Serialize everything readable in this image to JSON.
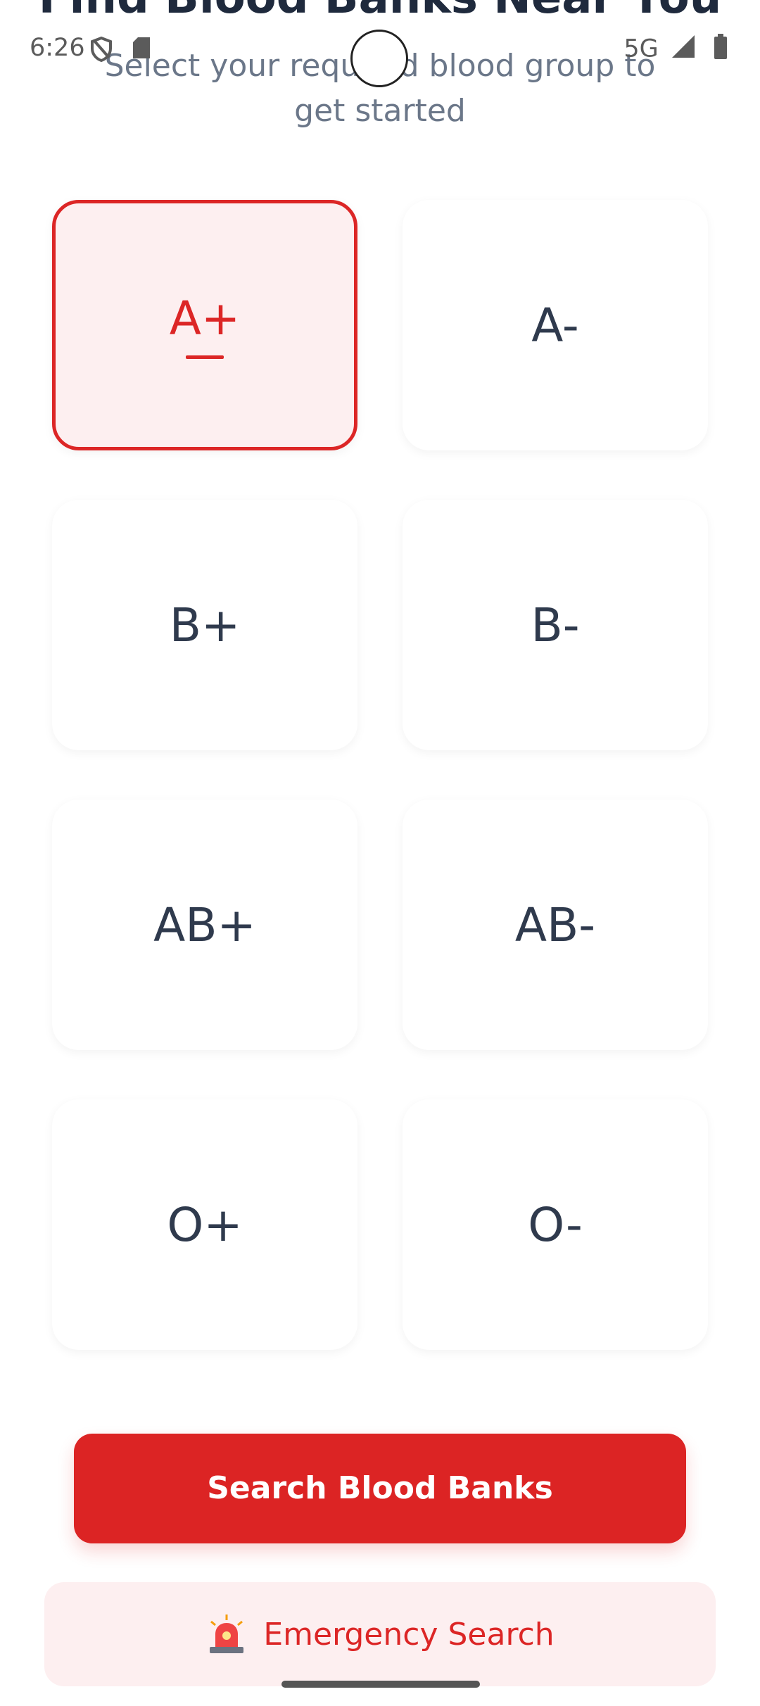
{
  "header": {
    "title": "Find Blood Banks Near You",
    "subtitle": "Select your required blood group to get started"
  },
  "status_bar": {
    "time": "6:26",
    "network": "5G"
  },
  "blood_groups": [
    {
      "label": "A+",
      "selected": true
    },
    {
      "label": "A-",
      "selected": false
    },
    {
      "label": "B+",
      "selected": false
    },
    {
      "label": "B-",
      "selected": false
    },
    {
      "label": "AB+",
      "selected": false
    },
    {
      "label": "AB-",
      "selected": false
    },
    {
      "label": "O+",
      "selected": false
    },
    {
      "label": "O-",
      "selected": false
    }
  ],
  "actions": {
    "search_label": "Search Blood Banks",
    "emergency_label": "Emergency Search",
    "emergency_icon": "siren-icon"
  },
  "colors": {
    "accent": "#dc2626",
    "selected_bg": "#fdeff0"
  }
}
